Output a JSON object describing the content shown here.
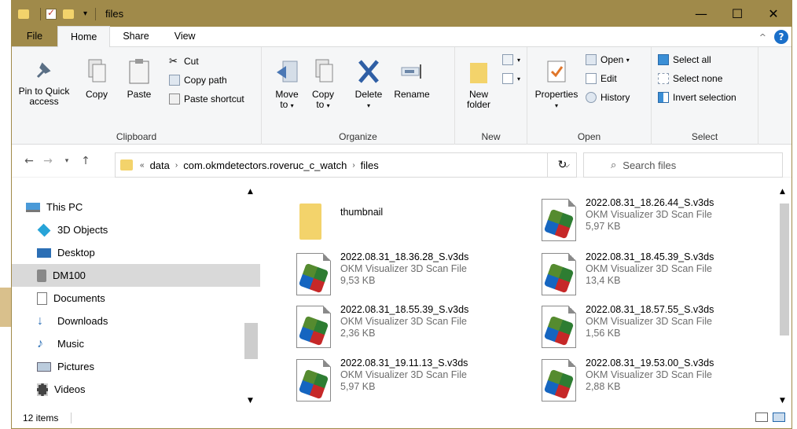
{
  "window": {
    "title": "files",
    "controls": {
      "minimize": "—",
      "maximize": "☐",
      "close": "✕"
    }
  },
  "ribbon_tabs": [
    "File",
    "Home",
    "Share",
    "View"
  ],
  "ribbon": {
    "clipboard": {
      "label": "Clipboard",
      "pin": "Pin to Quick access",
      "copy": "Copy",
      "paste": "Paste",
      "cut": "Cut",
      "copy_path": "Copy path",
      "paste_shortcut": "Paste shortcut"
    },
    "organize": {
      "label": "Organize",
      "move_to": "Move to",
      "copy_to": "Copy to",
      "delete": "Delete",
      "rename": "Rename"
    },
    "new": {
      "label": "New",
      "new_folder": "New folder"
    },
    "open": {
      "label": "Open",
      "properties": "Properties",
      "open": "Open",
      "edit": "Edit",
      "history": "History"
    },
    "select": {
      "label": "Select",
      "select_all": "Select all",
      "select_none": "Select none",
      "invert_selection": "Invert selection"
    }
  },
  "address": {
    "crumbs": [
      "data",
      "com.okmdetectors.roveruc_c_watch",
      "files"
    ],
    "overflow": "«",
    "search_placeholder": "Search files"
  },
  "nav": [
    {
      "label": "This PC"
    },
    {
      "label": "3D Objects"
    },
    {
      "label": "Desktop"
    },
    {
      "label": "DM100"
    },
    {
      "label": "Documents"
    },
    {
      "label": "Downloads"
    },
    {
      "label": "Music"
    },
    {
      "label": "Pictures"
    },
    {
      "label": "Videos"
    }
  ],
  "files": [
    {
      "name": "thumbnail",
      "type": "",
      "size": ""
    },
    {
      "name": "2022.08.31_18.26.44_S.v3ds",
      "type": "OKM Visualizer 3D Scan File",
      "size": "5,97 KB"
    },
    {
      "name": "2022.08.31_18.36.28_S.v3ds",
      "type": "OKM Visualizer 3D Scan File",
      "size": "9,53 KB"
    },
    {
      "name": "2022.08.31_18.45.39_S.v3ds",
      "type": "OKM Visualizer 3D Scan File",
      "size": "13,4 KB"
    },
    {
      "name": "2022.08.31_18.55.39_S.v3ds",
      "type": "OKM Visualizer 3D Scan File",
      "size": "2,36 KB"
    },
    {
      "name": "2022.08.31_18.57.55_S.v3ds",
      "type": "OKM Visualizer 3D Scan File",
      "size": "1,56 KB"
    },
    {
      "name": "2022.08.31_19.11.13_S.v3ds",
      "type": "OKM Visualizer 3D Scan File",
      "size": "5,97 KB"
    },
    {
      "name": "2022.08.31_19.53.00_S.v3ds",
      "type": "OKM Visualizer 3D Scan File",
      "size": "2,88 KB"
    }
  ],
  "status": {
    "count": "12 items"
  },
  "colors": {
    "titlebar": "#a08a4a",
    "accent": "#1a6fc9",
    "folder": "#f3d36b",
    "selected": "#d9d9d9"
  }
}
